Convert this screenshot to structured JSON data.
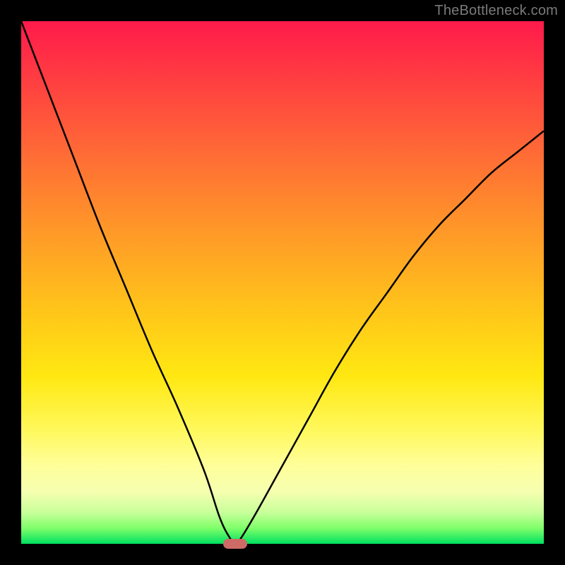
{
  "watermark": "TheBottleneck.com",
  "colors": {
    "curve_stroke": "#000000",
    "marker_fill": "#cf6b66"
  },
  "chart_data": {
    "type": "line",
    "title": "",
    "xlabel": "",
    "ylabel": "",
    "xlim": [
      0,
      100
    ],
    "ylim": [
      0,
      100
    ],
    "grid": false,
    "legend": false,
    "series": [
      {
        "name": "bottleneck-curve",
        "x": [
          0,
          5,
          10,
          15,
          20,
          25,
          30,
          35,
          38,
          40,
          41,
          42,
          45,
          50,
          55,
          60,
          65,
          70,
          75,
          80,
          85,
          90,
          95,
          100
        ],
        "y": [
          100,
          87,
          74,
          61,
          49,
          37,
          26,
          14,
          5,
          1,
          0,
          1,
          6,
          15,
          24,
          33,
          41,
          48,
          55,
          61,
          66,
          71,
          75,
          79
        ]
      }
    ],
    "marker": {
      "x": 41,
      "y": 0
    },
    "annotations": []
  }
}
